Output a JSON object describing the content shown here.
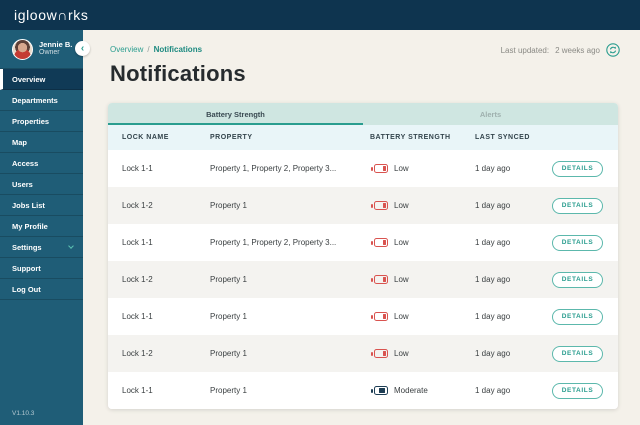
{
  "topbar": {
    "logo": "igloow∩rks"
  },
  "sidebar": {
    "user": {
      "name": "Jennie B.",
      "role": "Owner"
    },
    "items": [
      {
        "label": "Overview",
        "active": true
      },
      {
        "label": "Departments"
      },
      {
        "label": "Properties"
      },
      {
        "label": "Map"
      },
      {
        "label": "Access"
      },
      {
        "label": "Users"
      },
      {
        "label": "Jobs List"
      },
      {
        "label": "My Profile"
      },
      {
        "label": "Settings",
        "has_chevron": true
      },
      {
        "label": "Support"
      },
      {
        "label": "Log Out"
      }
    ],
    "version": "V1.10.3"
  },
  "header": {
    "breadcrumb": {
      "parent": "Overview",
      "separator": "/",
      "current": "Notifications"
    },
    "last_updated_label": "Last updated:",
    "last_updated_value": "2 weeks ago",
    "title": "Notifications"
  },
  "tabs": [
    {
      "label": "Battery Strength",
      "active": true
    },
    {
      "label": "Alerts",
      "active": false
    }
  ],
  "table": {
    "columns": [
      "LOCK NAME",
      "PROPERTY",
      "BATTERY STRENGTH",
      "LAST SYNCED"
    ],
    "details_label": "DETAILS",
    "rows": [
      {
        "lock": "Lock 1-1",
        "property": "Property 1, Property 2, Property 3...",
        "battery": "Low",
        "battery_level": "low",
        "synced": "1 day ago"
      },
      {
        "lock": "Lock 1-2",
        "property": "Property 1",
        "battery": "Low",
        "battery_level": "low",
        "synced": "1 day ago"
      },
      {
        "lock": "Lock 1-1",
        "property": "Property 1, Property 2, Property 3...",
        "battery": "Low",
        "battery_level": "low",
        "synced": "1 day ago"
      },
      {
        "lock": "Lock 1-2",
        "property": "Property 1",
        "battery": "Low",
        "battery_level": "low",
        "synced": "1 day ago"
      },
      {
        "lock": "Lock 1-1",
        "property": "Property 1",
        "battery": "Low",
        "battery_level": "low",
        "synced": "1 day ago"
      },
      {
        "lock": "Lock 1-2",
        "property": "Property 1",
        "battery": "Low",
        "battery_level": "low",
        "synced": "1 day ago"
      },
      {
        "lock": "Lock 1-1",
        "property": "Property 1",
        "battery": "Moderate",
        "battery_level": "moderate",
        "synced": "1 day ago"
      }
    ]
  },
  "colors": {
    "topbar_bg": "#0e344f",
    "sidebar_bg": "#1f5d77",
    "active_item_bg": "#103a56",
    "accent_teal": "#2a9d8f",
    "tabbar_bg": "#cfe6e1",
    "table_header_bg": "#e9f5f8",
    "battery_low": "#d9534f",
    "battery_moderate": "#1d3d54",
    "page_bg": "#f4f1ea"
  }
}
